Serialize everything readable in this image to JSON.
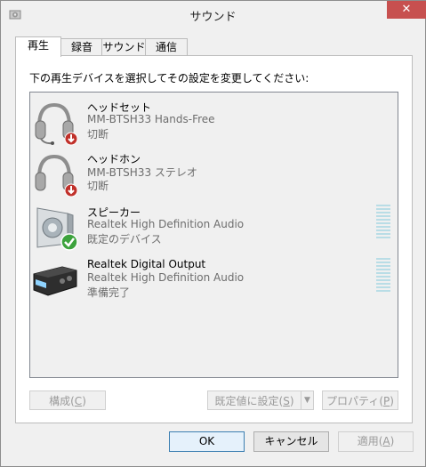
{
  "window": {
    "title": "サウンド",
    "close_label": "✕"
  },
  "tabs": [
    {
      "label": "再生"
    },
    {
      "label": "録音"
    },
    {
      "label": "サウンド"
    },
    {
      "label": "通信"
    }
  ],
  "panel": {
    "instruction": "下の再生デバイスを選択してその設定を変更してください:"
  },
  "devices": [
    {
      "name": "ヘッドセット",
      "description": "MM-BTSH33 Hands-Free",
      "status": "切断",
      "icon": "headset-icon",
      "badge": "disconnected-badge-icon"
    },
    {
      "name": "ヘッドホン",
      "description": "MM-BTSH33 ステレオ",
      "status": "切断",
      "icon": "headphones-icon",
      "badge": "disconnected-badge-icon"
    },
    {
      "name": "スピーカー",
      "description": "Realtek High Definition Audio",
      "status": "既定のデバイス",
      "icon": "speaker-icon",
      "badge": "default-check-icon"
    },
    {
      "name": "Realtek Digital Output",
      "description": "Realtek High Definition Audio",
      "status": "準備完了",
      "icon": "digital-output-icon"
    }
  ],
  "panel_buttons": {
    "configure": {
      "text": "構成(",
      "key": "C",
      "end": ")"
    },
    "set_default": {
      "text": "既定値に設定(",
      "key": "S",
      "end": ")"
    },
    "properties": {
      "text": "プロパティ(",
      "key": "P",
      "end": ")"
    }
  },
  "dialog_buttons": {
    "ok": "OK",
    "cancel": "キャンセル",
    "apply": {
      "text": "適用(",
      "key": "A",
      "end": ")"
    }
  },
  "colors": {
    "close_red": "#c7504f",
    "meter": "#b9dde6",
    "check_green": "#3da33d",
    "disconnect_red": "#c0302a"
  }
}
